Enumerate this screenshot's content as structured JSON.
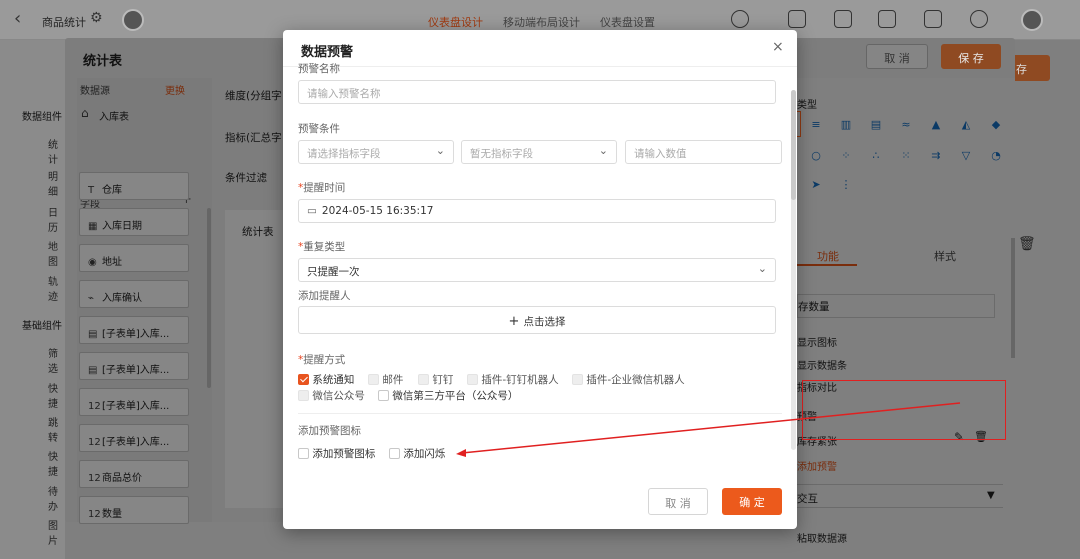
{
  "app": {
    "title": "商品统计",
    "tabs": [
      "仪表盘设计",
      "移动端布局设计",
      "仪表盘设置"
    ]
  },
  "leftbar": {
    "sections": [
      "数据组件",
      "基础组件"
    ],
    "items": [
      "统计",
      "明细",
      "日历",
      "地图",
      "轨迹",
      "筛选",
      "快捷",
      "跳转",
      "快捷",
      "待办",
      "图片"
    ]
  },
  "stat_dialog": {
    "title": "统计表",
    "cancel": "取 消",
    "save": "保 存",
    "save_behind": "存",
    "datasource_label": "数据源",
    "change_link": "更换",
    "datasource_name": "入库表",
    "fields_label": "字段",
    "fields": [
      {
        "icon": "T",
        "name": "仓库"
      },
      {
        "icon": "▦",
        "name": "入库日期"
      },
      {
        "icon": "◉",
        "name": "地址"
      },
      {
        "icon": "⌁",
        "name": "入库确认"
      },
      {
        "icon": "▤",
        "name": "[子表单]入库..."
      },
      {
        "icon": "▤",
        "name": "[子表单]入库..."
      },
      {
        "icon": "12",
        "name": "[子表单]入库..."
      },
      {
        "icon": "12",
        "name": "[子表单]入库..."
      },
      {
        "icon": "12",
        "name": "商品总价"
      },
      {
        "icon": "12",
        "name": "数量"
      }
    ],
    "dimension_label": "维度(分组字",
    "indicator_label": "指标(汇总字",
    "filter_label": "条件过滤",
    "preview_title": "统计表",
    "chart_type_label": "类型",
    "right_tabs": [
      "功能",
      "样式"
    ],
    "indicator_name": "存数量",
    "checks": [
      "显示图标",
      "显示数据条",
      "指标对比"
    ],
    "warning_section": "预警",
    "warning_item": "库存紧张",
    "add_warning": "添加预警",
    "interaction": "交互",
    "fetch_source": "粘取数据源"
  },
  "modal": {
    "title": "数据预警",
    "close": "×",
    "name_label": "预警名称",
    "name_placeholder": "请输入预警名称",
    "condition_label": "预警条件",
    "cond_field_placeholder": "请选择指标字段",
    "cond_op_placeholder": "暂无指标字段",
    "cond_value_placeholder": "请输入数值",
    "remind_time_label": "提醒时间",
    "remind_time_value": "2024-05-15 16:35:17",
    "repeat_label": "重复类型",
    "repeat_value": "只提醒一次",
    "add_reminder_label": "添加提醒人",
    "click_select": "点击选择",
    "method_label": "提醒方式",
    "methods": [
      {
        "label": "系统通知",
        "checked": true,
        "disabled": false
      },
      {
        "label": "邮件",
        "checked": false,
        "disabled": true
      },
      {
        "label": "钉钉",
        "checked": false,
        "disabled": true
      },
      {
        "label": "插件-钉钉机器人",
        "checked": false,
        "disabled": true
      },
      {
        "label": "插件-企业微信机器人",
        "checked": false,
        "disabled": true
      },
      {
        "label": "微信公众号",
        "checked": false,
        "disabled": true
      },
      {
        "label": "微信第三方平台（公众号）",
        "checked": false,
        "disabled": false
      }
    ],
    "icon_section_label": "添加预警图标",
    "add_icon_option": "添加预警图标",
    "add_flash_option": "添加闪烁",
    "cancel": "取 消",
    "ok": "确 定"
  },
  "colors": {
    "accent": "#ec5a1c",
    "annotation": "#e02020"
  }
}
